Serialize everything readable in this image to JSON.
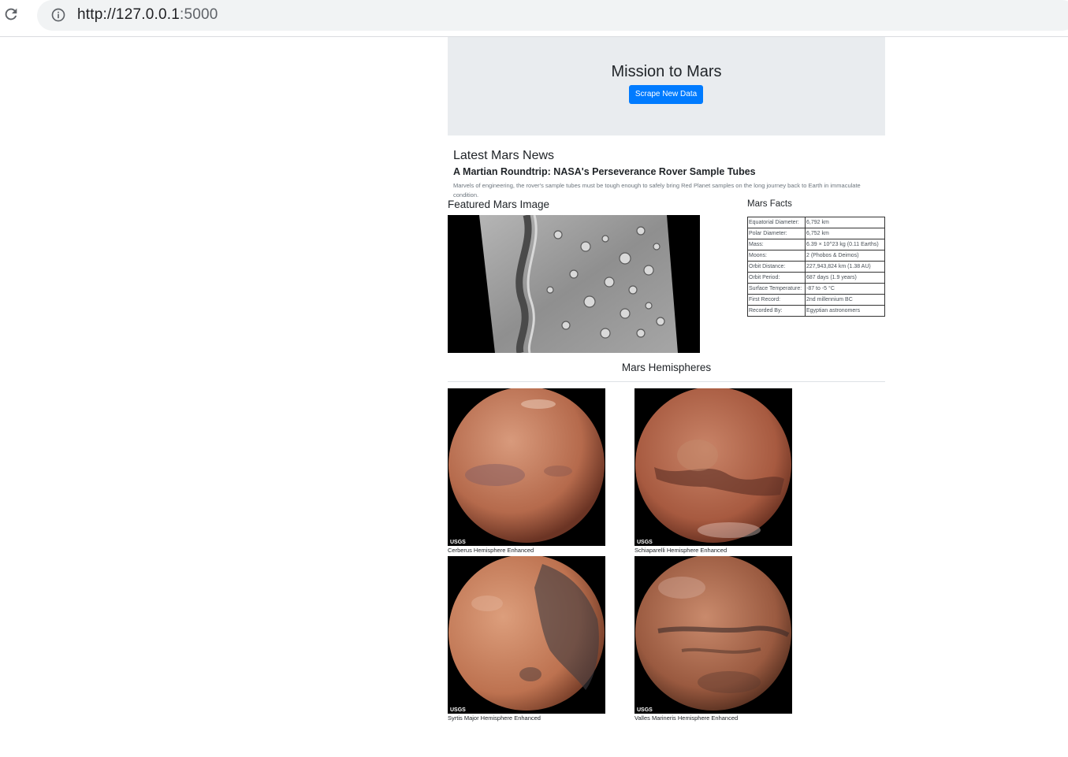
{
  "browser": {
    "url_host": "http://127.0.0.1",
    "url_port": ":5000"
  },
  "jumbotron": {
    "title": "Mission to Mars",
    "button_label": "Scrape New Data",
    "button_color": "#007bff"
  },
  "news": {
    "heading": "Latest Mars News",
    "title": "A Martian Roundtrip: NASA's Perseverance Rover Sample Tubes",
    "paragraph": "Marvels of engineering, the rover's sample tubes must be tough enough to safely bring Red Planet samples on the long journey back to Earth in immaculate condition."
  },
  "featured": {
    "heading": "Featured Mars Image"
  },
  "facts": {
    "heading": "Mars Facts",
    "rows": [
      {
        "label": "Equatorial Diameter:",
        "value": "6,792 km"
      },
      {
        "label": "Polar Diameter:",
        "value": "6,752 km"
      },
      {
        "label": "Mass:",
        "value": "6.39 × 10^23 kg (0.11 Earths)"
      },
      {
        "label": "Moons:",
        "value": "2 (Phobos & Deimos)"
      },
      {
        "label": "Orbit Distance:",
        "value": "227,943,824 km (1.38 AU)"
      },
      {
        "label": "Orbit Period:",
        "value": "687 days (1.9 years)"
      },
      {
        "label": "Surface Temperature:",
        "value": "-87 to -5 °C"
      },
      {
        "label": "First Record:",
        "value": "2nd millennium BC"
      },
      {
        "label": "Recorded By:",
        "value": "Egyptian astronomers"
      }
    ]
  },
  "hemispheres": {
    "heading": "Mars Hemispheres",
    "items": [
      {
        "caption": "Cerberus Hemisphere Enhanced",
        "logo": "USGS"
      },
      {
        "caption": "Schiaparelli Hemisphere Enhanced",
        "logo": "USGS"
      },
      {
        "caption": "Syrtis Major Hemisphere Enhanced",
        "logo": "USGS"
      },
      {
        "caption": "Valles Marineris Hemisphere Enhanced",
        "logo": "USGS"
      }
    ]
  }
}
